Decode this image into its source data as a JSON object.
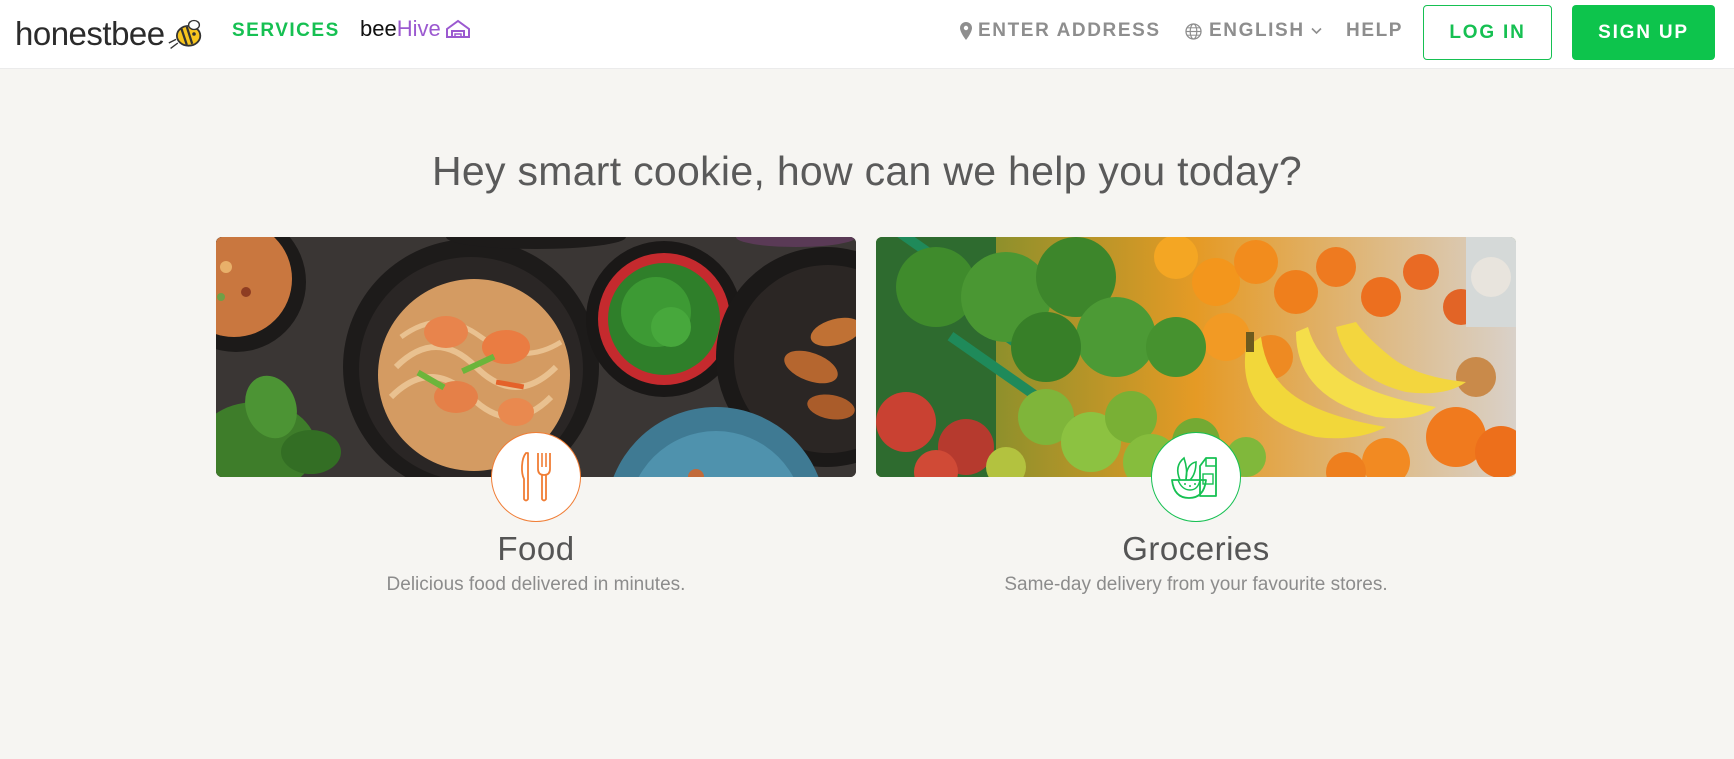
{
  "header": {
    "logo_text": "honestbee",
    "nav_services": "SERVICES",
    "beehive_part1": "bee",
    "beehive_part2": "Hive",
    "enter_address": "ENTER ADDRESS",
    "language": "ENGLISH",
    "help": "HELP",
    "login": "LOG IN",
    "signup": "SIGN UP"
  },
  "main": {
    "headline": "Hey smart cookie, how can we help you today?",
    "cards": [
      {
        "title": "Food",
        "description": "Delicious food delivered in minutes.",
        "icon": "cutlery-icon",
        "accent": "#f07d35"
      },
      {
        "title": "Groceries",
        "description": "Same-day delivery from your favourite stores.",
        "icon": "groceries-icon",
        "accent": "#16c052"
      }
    ]
  },
  "colors": {
    "brand_green": "#16c052",
    "beehive_purple": "#9b59d0",
    "page_bg": "#f6f5f2",
    "food_orange": "#f07d35"
  }
}
